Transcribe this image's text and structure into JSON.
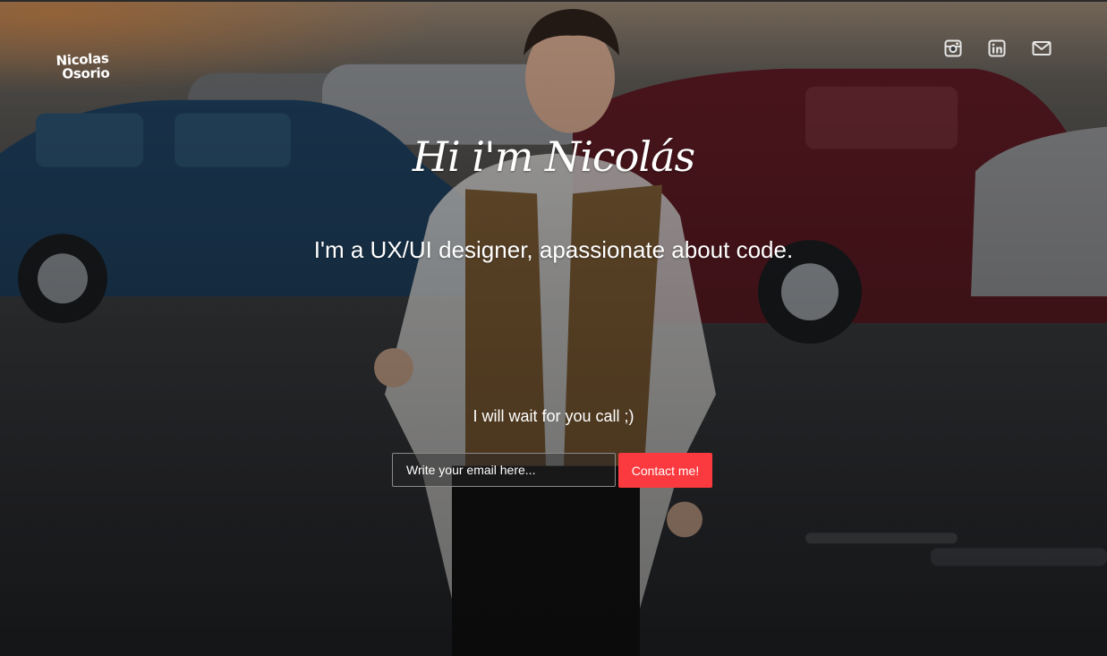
{
  "logo": {
    "line1": "Nicolas",
    "line2": "Osorio"
  },
  "social": [
    {
      "icon": "instagram-icon"
    },
    {
      "icon": "linkedin-icon"
    },
    {
      "icon": "mail-icon"
    }
  ],
  "hero": {
    "greeting": "Hi i'm Nicolás",
    "tagline": "I'm a UX/UI designer, apassionate about code.",
    "call_to_action": "I will wait for you call ;)"
  },
  "contact_form": {
    "email_placeholder": "Write your email here...",
    "email_value": "",
    "submit_label": "Contact me!"
  },
  "colors": {
    "accent": "#fb3a3f",
    "text": "#ffffff"
  }
}
